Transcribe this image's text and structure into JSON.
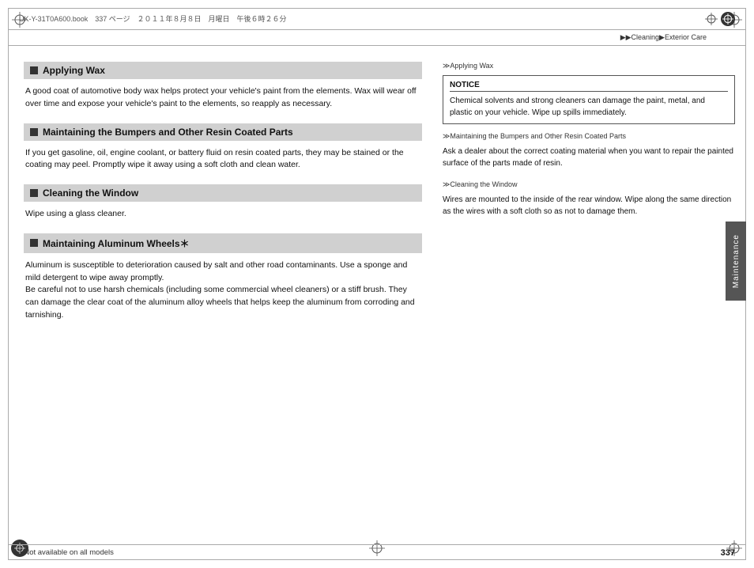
{
  "header": {
    "file_info": "UK-Y-31T0A600.book　337 ページ　２０１１年８月８日　月曜日　午後６時２６分"
  },
  "breadcrumb": {
    "text": "▶▶Cleaning▶Exterior Care"
  },
  "page_number": "337",
  "footer_note": "* Not available on all models",
  "side_tab": "Maintenance",
  "left_sections": [
    {
      "id": "applying-wax",
      "title": "Applying Wax",
      "body": "A good coat of automotive body wax helps protect your vehicle's paint from the elements. Wax will wear off over time and expose your vehicle's paint to the elements, so reapply as necessary."
    },
    {
      "id": "maintaining-bumpers",
      "title": "Maintaining the Bumpers and Other Resin Coated Parts",
      "body": "If you get gasoline, oil, engine coolant, or battery fluid on resin coated parts, they may be stained or the coating may peel. Promptly wipe it away using a soft cloth and clean water."
    },
    {
      "id": "cleaning-window",
      "title": "Cleaning the Window",
      "body": "Wipe using a glass cleaner."
    },
    {
      "id": "maintaining-aluminum",
      "title": "Maintaining Aluminum Wheels＊",
      "body": "Aluminum is susceptible to deterioration caused by salt and other road contaminants. Use a sponge and mild detergent to wipe away promptly.\nBe careful not to use harsh chemicals (including some commercial wheel cleaners) or a stiff brush. They can damage the clear coat of the aluminum alloy wheels that helps keep the aluminum from corroding and tarnishing."
    }
  ],
  "right_sections": [
    {
      "id": "right-applying-wax",
      "label": "≫Applying Wax",
      "notice": {
        "title": "NOTICE",
        "body": "Chemical solvents and strong cleaners can damage the paint, metal, and plastic on your vehicle. Wipe up spills immediately."
      }
    },
    {
      "id": "right-maintaining-bumpers",
      "label": "≫Maintaining the Bumpers and Other Resin Coated Parts",
      "body": "Ask a dealer about the correct coating material when you want to repair the painted surface of the parts made of resin."
    },
    {
      "id": "right-cleaning-window",
      "label": "≫Cleaning the Window",
      "body": "Wires are mounted to the inside of the rear window. Wipe along the same direction as the wires with a soft cloth so as not to damage them."
    }
  ]
}
